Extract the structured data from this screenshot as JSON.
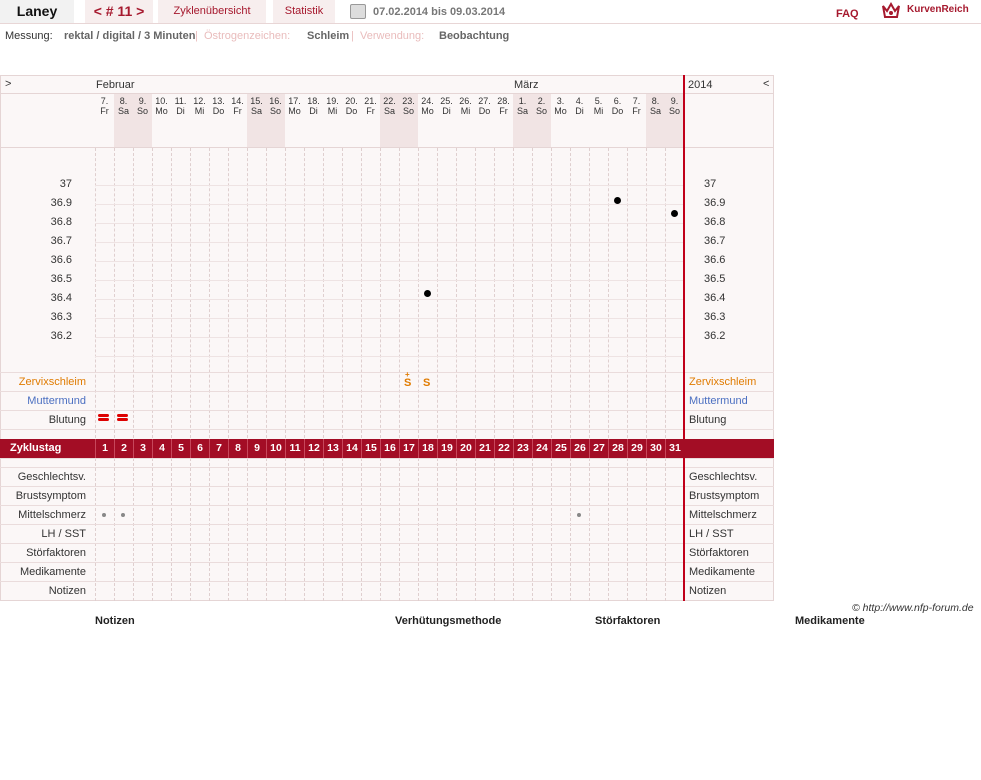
{
  "header": {
    "user_name": "Laney",
    "cycle_label": "< # 11 >",
    "tab_cycles": "Zyklenübersicht",
    "tab_stats": "Statistik",
    "date_range": "07.02.2014 bis 09.03.2014",
    "faq": "FAQ",
    "logo_text": "KurvenReich"
  },
  "info": {
    "measure_label": "Messung:",
    "measure_value": "rektal / digital / 3 Minuten",
    "sep": "|",
    "sign_label": "Östrogenzeichen:",
    "sign_value": "Schleim",
    "use_label": "Verwendung:",
    "use_value": "Beobachtung"
  },
  "chart_nav": {
    "prev": ">",
    "next": "<",
    "month1": "Februar",
    "month2": "März",
    "year": "2014"
  },
  "days": [
    {
      "d": "7.",
      "w": "Fr",
      "we": false
    },
    {
      "d": "8.",
      "w": "Sa",
      "we": true
    },
    {
      "d": "9.",
      "w": "So",
      "we": true
    },
    {
      "d": "10.",
      "w": "Mo",
      "we": false
    },
    {
      "d": "11.",
      "w": "Di",
      "we": false
    },
    {
      "d": "12.",
      "w": "Mi",
      "we": false
    },
    {
      "d": "13.",
      "w": "Do",
      "we": false
    },
    {
      "d": "14.",
      "w": "Fr",
      "we": false
    },
    {
      "d": "15.",
      "w": "Sa",
      "we": true
    },
    {
      "d": "16.",
      "w": "So",
      "we": true
    },
    {
      "d": "17.",
      "w": "Mo",
      "we": false
    },
    {
      "d": "18.",
      "w": "Di",
      "we": false
    },
    {
      "d": "19.",
      "w": "Mi",
      "we": false
    },
    {
      "d": "20.",
      "w": "Do",
      "we": false
    },
    {
      "d": "21.",
      "w": "Fr",
      "we": false
    },
    {
      "d": "22.",
      "w": "Sa",
      "we": true
    },
    {
      "d": "23.",
      "w": "So",
      "we": true
    },
    {
      "d": "24.",
      "w": "Mo",
      "we": false
    },
    {
      "d": "25.",
      "w": "Di",
      "we": false
    },
    {
      "d": "26.",
      "w": "Mi",
      "we": false
    },
    {
      "d": "27.",
      "w": "Do",
      "we": false
    },
    {
      "d": "28.",
      "w": "Fr",
      "we": false
    },
    {
      "d": "1.",
      "w": "Sa",
      "we": true
    },
    {
      "d": "2.",
      "w": "So",
      "we": true
    },
    {
      "d": "3.",
      "w": "Mo",
      "we": false
    },
    {
      "d": "4.",
      "w": "Di",
      "we": false
    },
    {
      "d": "5.",
      "w": "Mi",
      "we": false
    },
    {
      "d": "6.",
      "w": "Do",
      "we": false
    },
    {
      "d": "7.",
      "w": "Fr",
      "we": false
    },
    {
      "d": "8.",
      "w": "Sa",
      "we": true
    },
    {
      "d": "9.",
      "w": "So",
      "we": true
    }
  ],
  "temp_axis": [
    "37",
    "36.9",
    "36.8",
    "36.7",
    "36.6",
    "36.5",
    "36.4",
    "36.3",
    "36.2"
  ],
  "temperatures": [
    {
      "cycle_day": 18,
      "temp": 36.43
    },
    {
      "cycle_day": 28,
      "temp": 36.92
    },
    {
      "cycle_day": 31,
      "temp": 36.85
    }
  ],
  "rows": {
    "cervical": "Zervixschleim",
    "cervix": "Muttermund",
    "bleeding": "Blutung",
    "cycle_day": "Zyklustag",
    "intercourse": "Geschlechtsv.",
    "breast": "Brustsymptom",
    "midpain": "Mittelschmerz",
    "lh": "LH / SST",
    "disturb": "Störfaktoren",
    "meds": "Medikamente",
    "notes": "Notizen"
  },
  "mucus_marks": [
    {
      "cycle_day": 17,
      "symbol": "S",
      "plus": "+"
    },
    {
      "cycle_day": 18,
      "symbol": "S",
      "plus": ""
    }
  ],
  "bleeding_days": [
    1,
    2
  ],
  "midpain_days": [
    1,
    2,
    26
  ],
  "cycle_days": [
    "1",
    "2",
    "3",
    "4",
    "5",
    "6",
    "7",
    "8",
    "9",
    "10",
    "11",
    "12",
    "13",
    "14",
    "15",
    "16",
    "17",
    "18",
    "19",
    "20",
    "21",
    "22",
    "23",
    "24",
    "25",
    "26",
    "27",
    "28",
    "29",
    "30",
    "31"
  ],
  "footer": {
    "copyright": "© http://www.nfp-forum.de",
    "notes": "Notizen",
    "method": "Verhütungsmethode",
    "disturb": "Störfaktoren",
    "meds": "Medikamente"
  },
  "colors": {
    "brand": "#a6192e",
    "cycle_bar": "#a30d25",
    "mucus": "#e07b00",
    "cervix": "#4b6fc1",
    "red_line": "#c0001a"
  }
}
